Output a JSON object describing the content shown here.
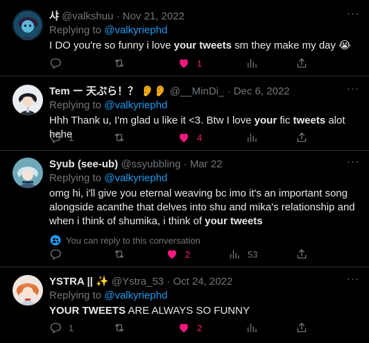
{
  "tweets": [
    {
      "name": "샤",
      "handle": "@valkshuu",
      "sep": "·",
      "date": "Nov 21, 2022",
      "reply_prefix": "Replying to",
      "reply_to": "@valkyriephd",
      "text_a": "I DO you're so funny i love ",
      "text_b": "your tweets",
      "text_c": " sm they make my day 😭",
      "like_count": "1",
      "reply_count": "",
      "views_count": ""
    },
    {
      "name": "Tem ー 天ぷら！？ 👂👂",
      "handle": "@__MinDi_",
      "sep": "·",
      "date": "Dec 6, 2022",
      "reply_prefix": "Replying to",
      "reply_to": "@valkyriephd",
      "text_a": "Hhh Thank u, I'm glad u like it <3. Btw I love ",
      "text_b": "your",
      "text_c": " fic ",
      "text_d": "tweets",
      "text_e": " alot hehe",
      "reply_count": "1",
      "like_count": "4",
      "views_count": ""
    },
    {
      "name": "Syub (see-ub)",
      "handle": "@ssyubbling",
      "sep": "·",
      "date": "Mar 22",
      "reply_prefix": "Replying to",
      "reply_to": "@valkyriephd",
      "text_a": "omg hi, i'll give you eternal weaving bc imo it's an important song alongside acanthe that delves into shu and mika's relationship and when i think of shumika, i think of ",
      "text_b": "your tweets",
      "hint": "You can reply to this conversation",
      "reply_count": "",
      "like_count": "2",
      "views_count": "53"
    },
    {
      "name": "YSTRA || ✨",
      "handle": "@Ystra_53",
      "sep": "·",
      "date": "Oct 24, 2022",
      "reply_prefix": "Replying to",
      "reply_to": "@valkyriephd",
      "text_a": "YOUR TWEETS",
      "text_b": " ARE ALWAYS SO FUNNY",
      "reply_count": "1",
      "like_count": "2",
      "views_count": ""
    }
  ],
  "more_glyph": "···",
  "colors": {
    "background": "#000000",
    "text": "#e7e9ea",
    "muted": "#71767b",
    "accent": "#1d9bf0",
    "like": "#f91880",
    "divider": "#2f3336"
  },
  "icons": [
    "reply-icon",
    "retweet-icon",
    "like-icon",
    "views-icon",
    "share-icon",
    "more-icon",
    "people-icon"
  ]
}
